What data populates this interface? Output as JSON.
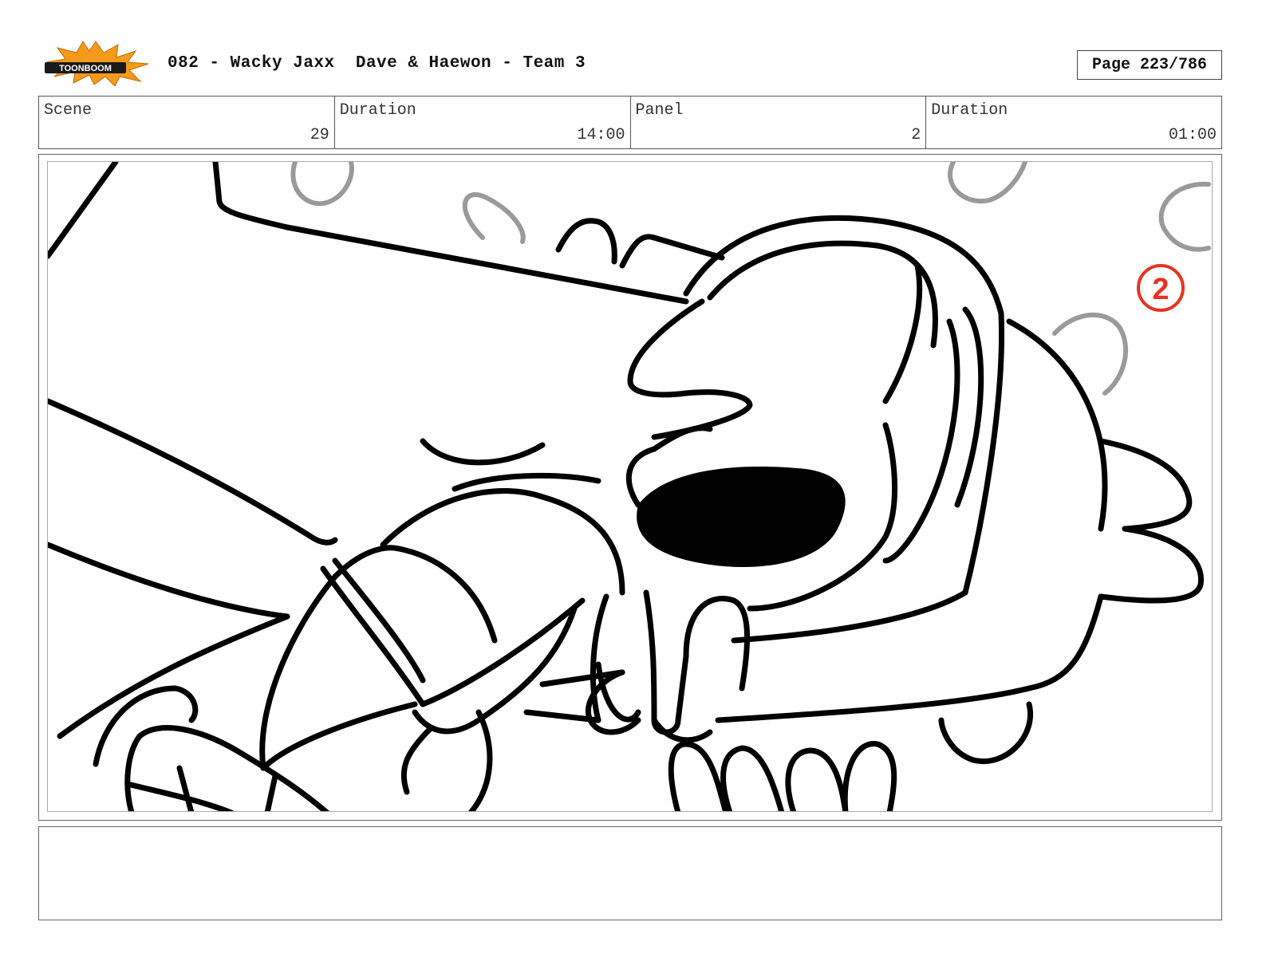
{
  "header": {
    "logo_text": "TOONBOOM",
    "title": "082 - Wacky Jaxx  Dave & Haewon - Team 3",
    "page": "Page 223/786"
  },
  "info": {
    "scene_label": "Scene",
    "scene_value": "29",
    "scene_duration_label": "Duration",
    "scene_duration_value": "14:00",
    "panel_label": "Panel",
    "panel_value": "2",
    "panel_duration_label": "Duration",
    "panel_duration_value": "01:00"
  },
  "panel": {
    "marker": "2",
    "marker_color": "#e8321e"
  },
  "notes": {
    "text": ""
  },
  "colors": {
    "logo_burst": "#f59a1b",
    "logo_text_bg": "#1a1a1a",
    "ink": "#000000",
    "sketch_gray": "#9a9a9a"
  }
}
